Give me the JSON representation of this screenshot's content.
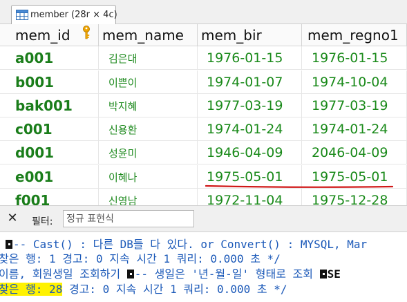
{
  "tab": {
    "label": "member (28r × 4c)"
  },
  "grid": {
    "columns": [
      "mem_id",
      "mem_name",
      "mem_bir",
      "mem_regno1"
    ],
    "rows": [
      [
        "a001",
        "김은대",
        "1976-01-15",
        "1976-01-15"
      ],
      [
        "b001",
        "이쁜이",
        "1974-01-07",
        "1974-10-04"
      ],
      [
        "bak001",
        "박지혜",
        "1977-03-19",
        "1977-03-19"
      ],
      [
        "c001",
        "신용환",
        "1974-01-24",
        "1974-01-24"
      ],
      [
        "d001",
        "성윤미",
        "1946-04-09",
        "2046-04-09"
      ],
      [
        "e001",
        "이혜나",
        "1975-05-01",
        "1975-05-01"
      ],
      [
        "f001",
        "신영남",
        "1972-11-04",
        "1975-12-28"
      ]
    ]
  },
  "filter": {
    "close": "✕",
    "label": "필터:",
    "placeholder": "정규 표현식"
  },
  "log": {
    "line1": "-- Cast() : 다른 DB들 다 있다.  or Convert() : MYSQL, Mar",
    "line2": "찾은 행: 1  경고: 0  지속 시간 1 쿼리: 0.000 초 */",
    "line3a": "이름, 회원생일 조회하기 ",
    "line3b": "-- 생일은 '년-월-일' 형태로 조회 ",
    "line3c": "SE",
    "line4a": "찾은 행: 28",
    "line4b": "  경고: 0  지속 시간 1 쿼리: 0.000 초 */"
  },
  "colors": {
    "text_green": "#1a8a1a",
    "log_blue": "#1a58b8",
    "underline_red": "#d01818",
    "highlight": "#fff200"
  },
  "icons": {
    "tab": "table-icon",
    "primary_key": "key-icon"
  }
}
